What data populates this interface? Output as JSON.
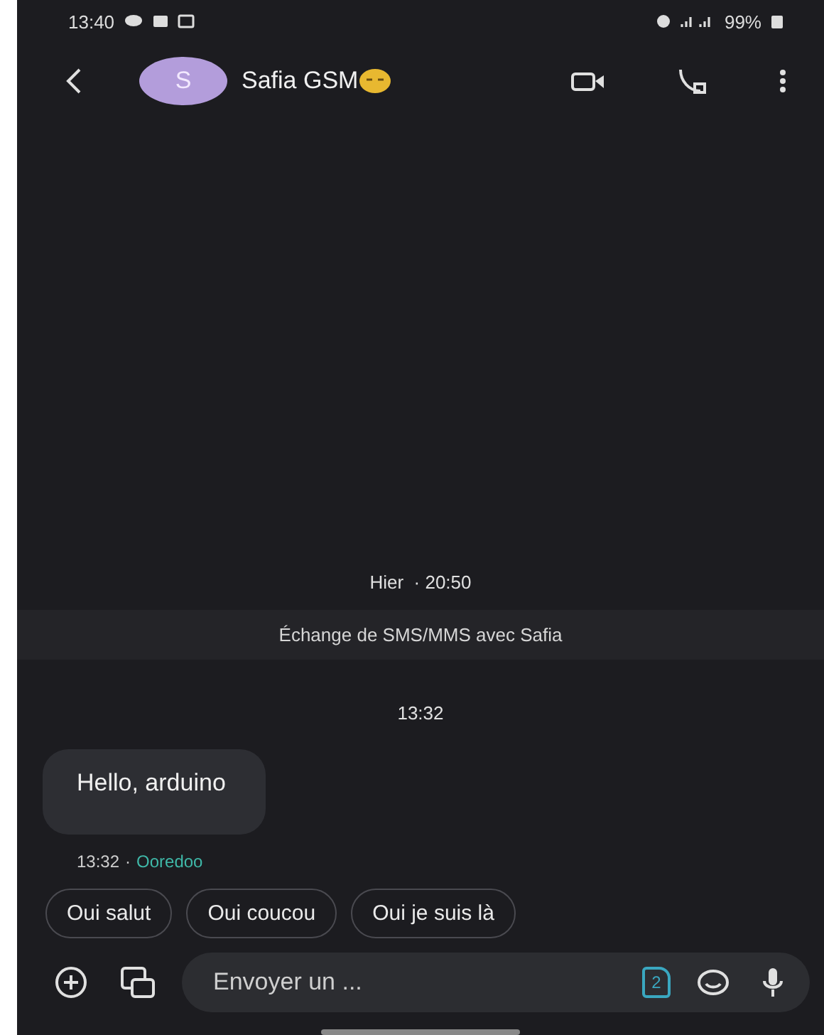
{
  "status_bar": {
    "time": "13:40",
    "battery": "99%"
  },
  "header": {
    "avatar_letter": "S",
    "contact_name": "Safia GSM"
  },
  "conversation": {
    "date_separator": "Hier  · 20:50",
    "banner": "Échange de SMS/MMS avec Safia",
    "time_separator": "13:32",
    "messages": [
      {
        "text": "Hello, arduino",
        "time": "13:32",
        "separator": "·",
        "carrier": "Ooredoo"
      }
    ]
  },
  "smart_replies": [
    "Oui salut",
    "Oui coucou",
    "Oui je suis là"
  ],
  "composer": {
    "placeholder": "Envoyer un ...",
    "sim_slot": "2"
  }
}
